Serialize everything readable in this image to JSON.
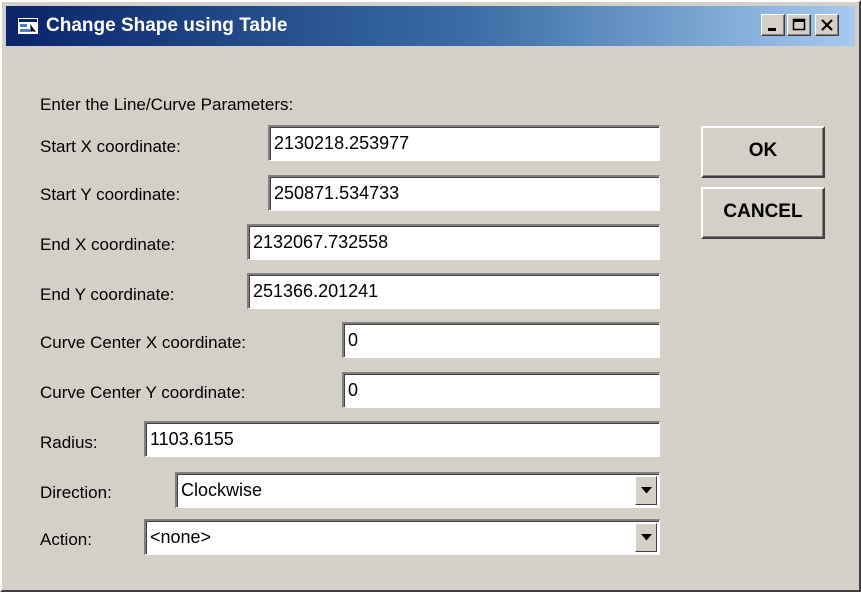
{
  "window": {
    "title": "Change Shape using Table",
    "controls": {
      "minimize": "minimize-icon",
      "maximize": "maximize-icon",
      "close": "close-icon"
    }
  },
  "form": {
    "heading": "Enter the Line/Curve Parameters:",
    "start_x": {
      "label": "Start X coordinate:",
      "value": "2130218.253977"
    },
    "start_y": {
      "label": "Start Y coordinate:",
      "value": "250871.534733"
    },
    "end_x": {
      "label": "End X coordinate:",
      "value": "2132067.732558"
    },
    "end_y": {
      "label": "End Y coordinate:",
      "value": "251366.201241"
    },
    "center_x": {
      "label": "Curve Center X coordinate:",
      "value": "0"
    },
    "center_y": {
      "label": "Curve Center Y coordinate:",
      "value": "0"
    },
    "radius": {
      "label": "Radius:",
      "value": "1103.6155"
    },
    "direction": {
      "label": "Direction:",
      "value": "Clockwise"
    },
    "action": {
      "label": "Action:",
      "value": "<none>"
    }
  },
  "buttons": {
    "ok": "OK",
    "cancel": "CANCEL"
  }
}
